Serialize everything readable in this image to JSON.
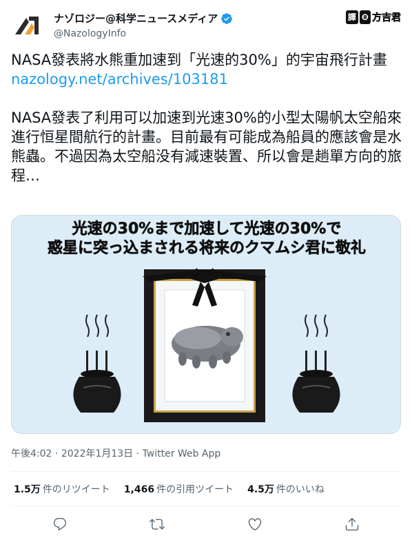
{
  "user": {
    "display_name": "ナゾロジー@科学ニュースメディア",
    "handle": "@NazologyInfo",
    "verified": true
  },
  "watermark": {
    "box_label": "譯",
    "box_icon": "❽",
    "text": "方吉君"
  },
  "tweet": {
    "title_line": "NASA發表將水熊重加速到「光速的30%」的宇宙飛行計畫",
    "link": "nazology.net/archives/103181",
    "body": "NASA發表了利用可以加速到光速30%的小型太陽帆太空船來進行恒星間航行的計畫。目前最有可能成為船員的應該會是水熊蟲。不過因為太空船没有減速裝置、所以會是趟單方向的旅程…"
  },
  "media": {
    "caption_line1": "光速の30%まで加速して光速の30%で",
    "caption_line2": "惑星に突っ込まされる将来のクマムシ君に敬礼",
    "background_color": "#dcedf8"
  },
  "meta": {
    "time": "午後4:02",
    "date": "2022年1月13日",
    "source": "Twitter Web App",
    "separator": "·"
  },
  "stats": {
    "retweets_value": "1.5万",
    "retweets_label": "件のリツイート",
    "quotes_value": "1,466",
    "quotes_label": "件の引用ツイート",
    "likes_value": "4.5万",
    "likes_label": "件のいいね"
  },
  "actions": [
    "reply-icon",
    "retweet-icon",
    "like-icon",
    "share-icon"
  ],
  "colors": {
    "link": "#1d9bf0",
    "verified": "#1d9bf0",
    "secondary_text": "#536471",
    "primary_text": "#0f1419"
  }
}
